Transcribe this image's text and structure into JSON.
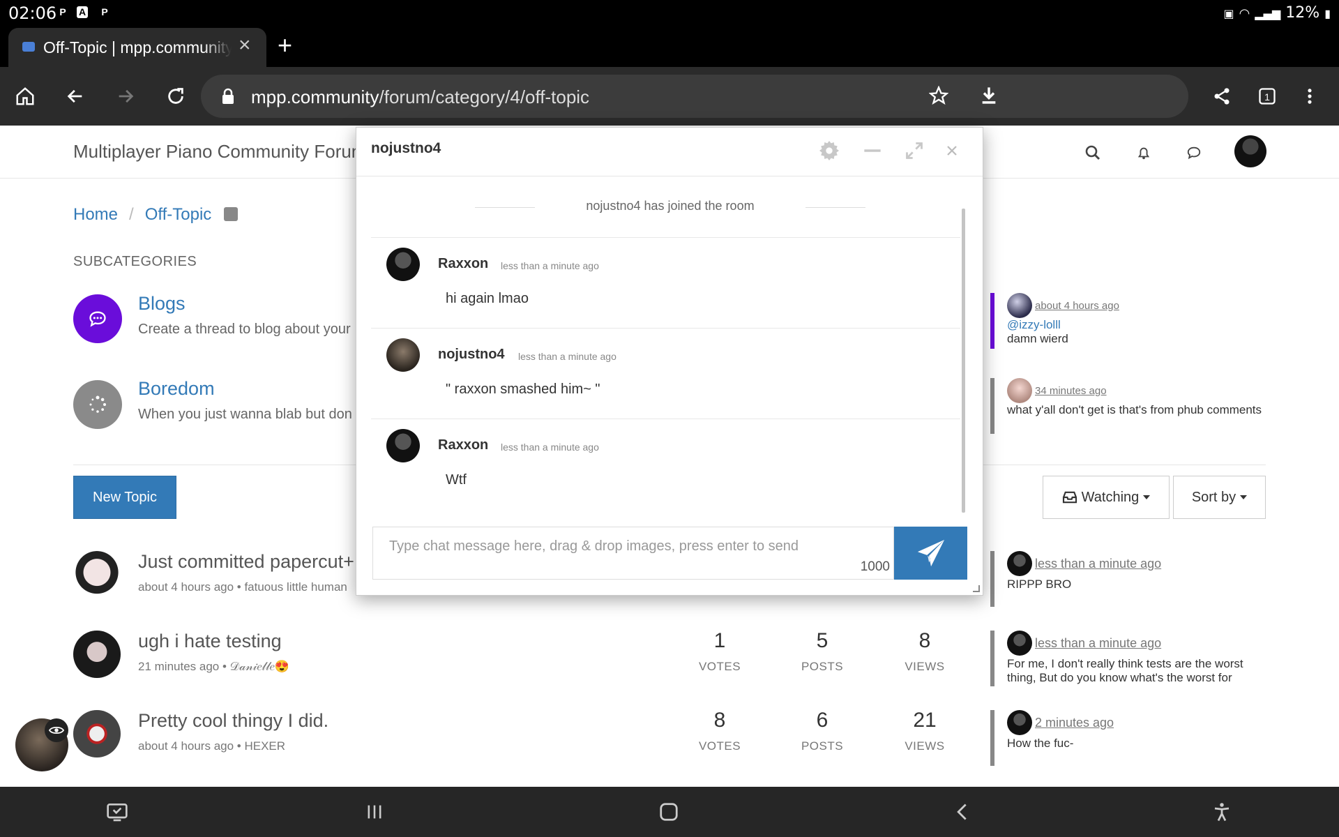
{
  "status": {
    "time": "02:06",
    "battery": "12%"
  },
  "browser": {
    "tab_title": "Off-Topic | mpp.community",
    "url_host": "mpp.community",
    "url_path": "/forum/category/4/off-topic"
  },
  "forum": {
    "title": "Multiplayer Piano Community Forum",
    "breadcrumb": [
      "Home",
      "Off-Topic"
    ],
    "subcategories_heading": "SUBCATEGORIES",
    "subcategories": [
      {
        "name": "Blogs",
        "desc": "Create a thread to blog about your"
      },
      {
        "name": "Boredom",
        "desc": "When you just wanna blab but don"
      }
    ],
    "teasers": [
      {
        "time": "about 4 hours ago",
        "mention": "@izzy-lolll",
        "text": "damn wierd"
      },
      {
        "time": "34 minutes ago",
        "text": "what y'all don't get is that's from phub comments"
      }
    ],
    "new_topic_label": "New Topic",
    "watching_label": "Watching",
    "sort_label": "Sort by",
    "stat_labels": {
      "votes": "VOTES",
      "posts": "POSTS",
      "views": "VIEWS"
    },
    "topics": [
      {
        "title": "Just committed papercut+",
        "meta": "about 4 hours ago • fatuous little human",
        "votes": "",
        "posts": "",
        "views": "",
        "teaser_time": "less than a minute ago",
        "teaser_text": "RIPPP BRO"
      },
      {
        "title": "ugh i hate testing",
        "meta": "21 minutes ago • 𝒟𝒶𝓃𝒾𝑒𝓁𝓁𝑒😍",
        "votes": "1",
        "posts": "5",
        "views": "8",
        "teaser_time": "less than a minute ago",
        "teaser_text": "For me, I don't really think tests are the worst thing, But do you know what's the worst for"
      },
      {
        "title": "Pretty cool thingy I did.",
        "meta": "about 4 hours ago • HEXER",
        "votes": "8",
        "posts": "6",
        "views": "21",
        "teaser_time": "2 minutes ago",
        "teaser_text": "How the fuc-"
      }
    ]
  },
  "chat": {
    "title": "nojustno4",
    "join_notice": "nojustno4 has joined the room",
    "messages": [
      {
        "user": "Raxxon",
        "time": "less than a minute ago",
        "text": "hi again lmao"
      },
      {
        "user": "nojustno4",
        "time": "less than a minute ago",
        "text": "\" raxxon smashed him~ \""
      },
      {
        "user": "Raxxon",
        "time": "less than a minute ago",
        "text": "Wtf"
      }
    ],
    "input_placeholder": "Type chat message here, drag & drop images, press enter to send",
    "char_count": "1000"
  },
  "colors": {
    "link": "#337ab7",
    "blogs_icon": "#6a0dda",
    "boredom_icon": "#8a8a8a"
  }
}
